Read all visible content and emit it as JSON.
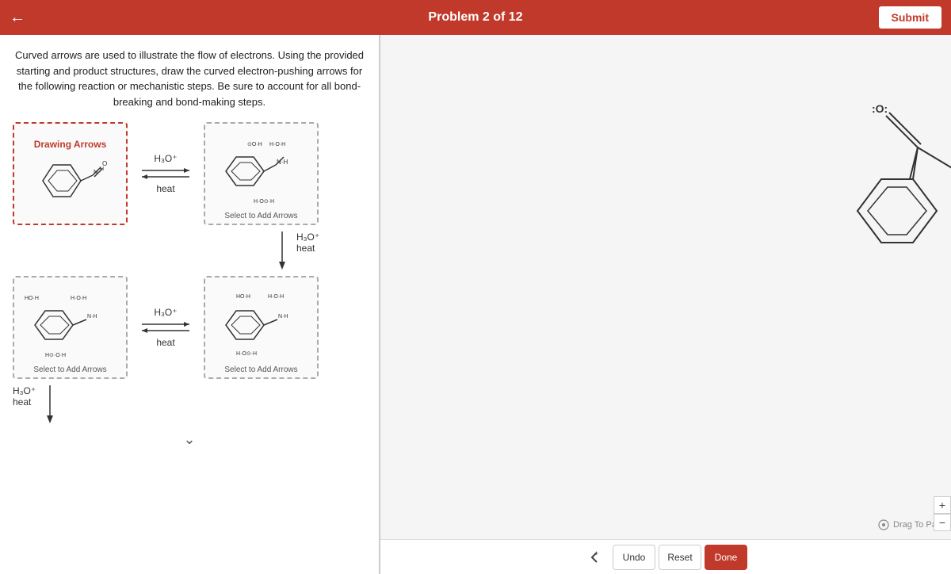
{
  "header": {
    "title": "Problem 2 of 12",
    "back_label": "←",
    "submit_label": "Submit"
  },
  "instructions": {
    "text": "Curved arrows are used to illustrate the flow of electrons. Using the provided starting and product structures, draw the curved electron-pushing arrows for the following reaction or mechanistic steps. Be sure to account for all bond-breaking and bond-making steps."
  },
  "reactions": [
    {
      "left_box": {
        "label": "Drawing Arrows",
        "type": "drawing"
      },
      "condition": {
        "reagent": "H₃O⁺",
        "heat": "heat"
      },
      "right_box": {
        "label": "Select to Add Arrows",
        "type": "select"
      }
    },
    {
      "left_box": {
        "label": "Select to Add Arrows",
        "type": "select"
      },
      "condition": {
        "reagent": "H₃O⁺",
        "heat": "heat"
      },
      "right_box": {
        "label": "Select to Add Arrows",
        "type": "select"
      }
    }
  ],
  "vertical_conditions": [
    {
      "reagent": "H₃O⁺",
      "heat": "heat"
    }
  ],
  "toolbar": {
    "undo_label": "Undo",
    "reset_label": "Reset",
    "done_label": "Done"
  },
  "drag_label": "Drag To Pan",
  "chevron_label": "∨",
  "bottom_conditions": {
    "reagent": "H₃O⁺",
    "heat": "heat"
  }
}
